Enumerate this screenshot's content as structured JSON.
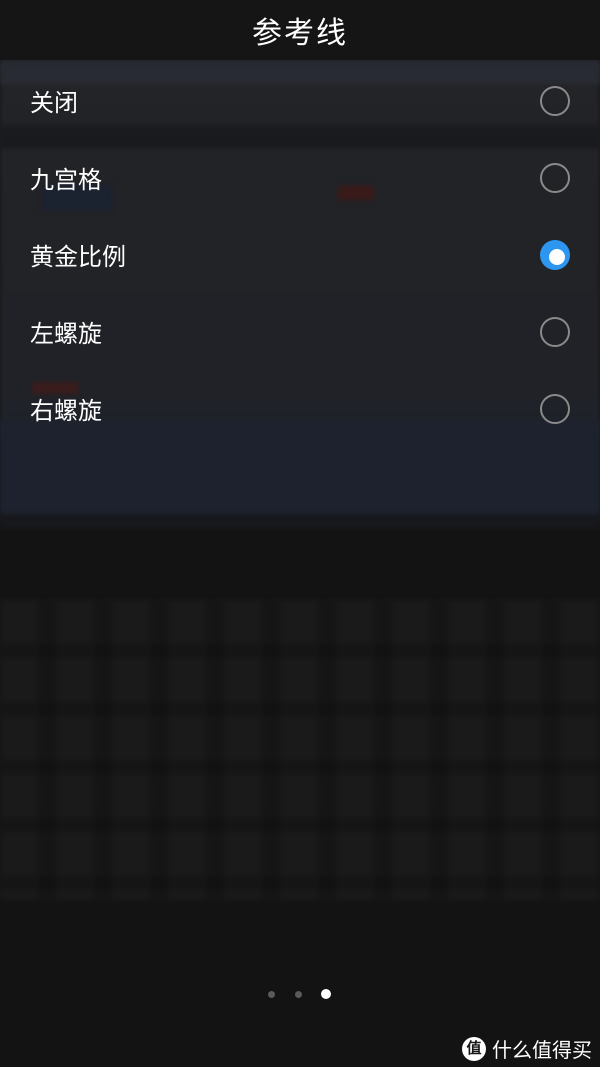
{
  "header": {
    "title": "参考线"
  },
  "options": [
    {
      "label": "关闭",
      "selected": false
    },
    {
      "label": "九宫格",
      "selected": false
    },
    {
      "label": "黄金比例",
      "selected": true
    },
    {
      "label": "左螺旋",
      "selected": false
    },
    {
      "label": "右螺旋",
      "selected": false
    }
  ],
  "pager": {
    "count": 3,
    "active_index": 2
  },
  "watermark": {
    "logo_glyph": "值",
    "text": "什么值得买"
  },
  "colors": {
    "accent": "#2d96f0",
    "background": "#161616",
    "text": "#ffffff"
  }
}
